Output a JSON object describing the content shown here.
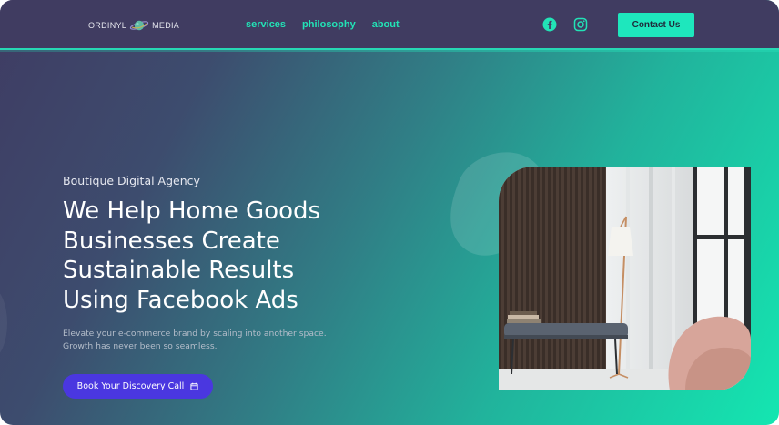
{
  "header": {
    "logo": {
      "left_text": "ORDINYL",
      "right_text": "MEDIA",
      "icon": "planet-logo-icon"
    },
    "nav": [
      {
        "label": "services"
      },
      {
        "label": "philosophy"
      },
      {
        "label": "about"
      }
    ],
    "social_icons": [
      "facebook-icon",
      "instagram-icon"
    ],
    "contact_label": "Contact Us"
  },
  "hero": {
    "eyebrow": "Boutique Digital Agency",
    "headline": "We Help Home Goods Businesses Create Sustainable Results Using Facebook Ads",
    "subtext": "Elevate your e-commerce brand by scaling into another space. Growth has never been so seamless.",
    "cta_label": "Book Your Discovery Call",
    "cta_icon": "calendar-icon"
  },
  "colors": {
    "header_bg": "#403c61",
    "accent": "#1ee7bd",
    "nav_link": "#22e3b6",
    "cta_bg": "#4a37e0",
    "gradient_start": "#3f3c63",
    "gradient_end": "#14e6b1"
  }
}
